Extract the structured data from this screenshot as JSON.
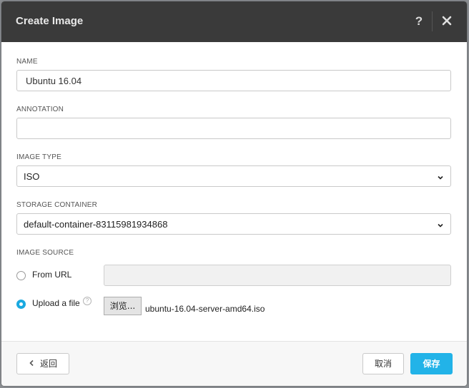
{
  "dialog": {
    "title": "Create Image",
    "help_label": "?"
  },
  "form": {
    "name_label": "NAME",
    "name_value": "Ubuntu 16.04",
    "annotation_label": "ANNOTATION",
    "annotation_value": "",
    "image_type_label": "IMAGE TYPE",
    "image_type_value": "ISO",
    "storage_container_label": "STORAGE CONTAINER",
    "storage_container_value": "default-container-83115981934868",
    "image_source_label": "IMAGE SOURCE",
    "from_url_label": "From URL",
    "from_url_value": "",
    "upload_label": "Upload a file",
    "upload_info": "?",
    "browse_label": "浏览...",
    "file_name": "ubuntu-16.04-server-amd64.iso",
    "selected_source": "upload"
  },
  "footer": {
    "back_label": "返回",
    "cancel_label": "取消",
    "save_label": "保存"
  },
  "colors": {
    "header_bg": "#3a3a3a",
    "accent": "#22b3e8"
  },
  "icons": {
    "close": "close-icon",
    "chevron": "chevron-down-icon",
    "back": "chevron-left-icon",
    "info": "info-icon"
  }
}
